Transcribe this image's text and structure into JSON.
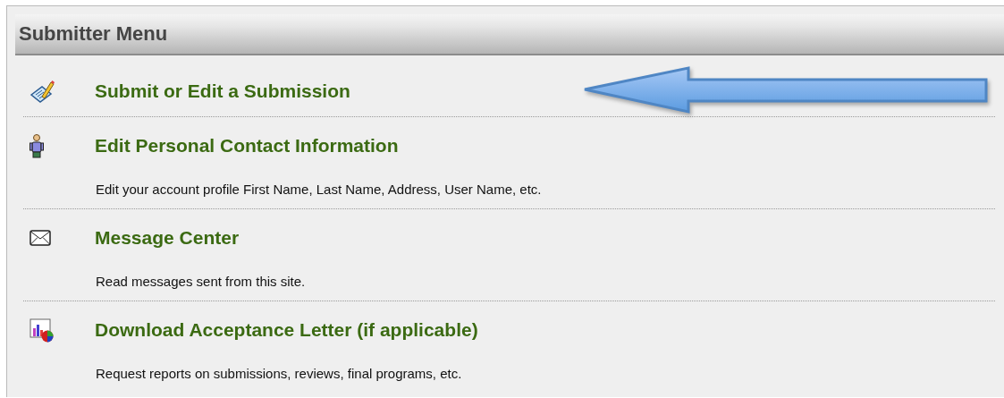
{
  "menu": {
    "title": "Submitter Menu",
    "items": [
      {
        "kind": "pencil",
        "label": "Submit or Edit a Submission"
      },
      {
        "kind": "person",
        "label": "Edit Personal Contact Information",
        "description": "Edit your account profile First Name, Last Name, Address, User Name, etc."
      },
      {
        "kind": "envelope",
        "label": "Message Center",
        "description": "Read messages sent from this site."
      },
      {
        "kind": "chart",
        "label": "Download Acceptance Letter (if applicable)",
        "description": "Request reports on submissions, reviews, final programs, etc."
      }
    ]
  }
}
